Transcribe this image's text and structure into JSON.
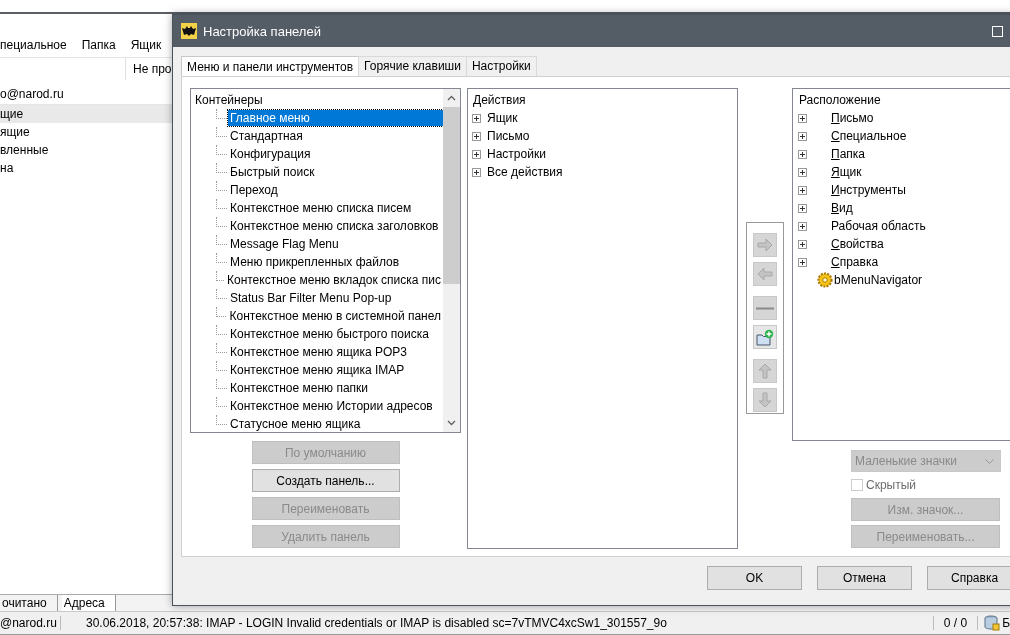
{
  "background_app": {
    "menu": [
      "пециальное",
      "Папка",
      "Ящик"
    ],
    "column_header": "Не про",
    "account": "o@narod.ru",
    "folders": [
      {
        "label": "щие",
        "selected": true
      },
      {
        "label": "ящие",
        "selected": false
      },
      {
        "label": "вленные",
        "selected": false
      },
      {
        "label": "на",
        "selected": false
      }
    ],
    "bottom_tabs": [
      {
        "label": "очитано",
        "selected": false
      },
      {
        "label": "Адреса",
        "selected": true
      }
    ]
  },
  "dialog": {
    "title": "Настройка панелей",
    "tabs": [
      {
        "label": "Меню и панели инструментов",
        "selected": true
      },
      {
        "label": "Горячие клавиши",
        "selected": false
      },
      {
        "label": "Настройки",
        "selected": false
      }
    ],
    "containers": {
      "heading": "Контейнеры",
      "items": [
        {
          "label": "Главное меню",
          "selected": true
        },
        {
          "label": "Стандартная",
          "selected": false
        },
        {
          "label": "Конфигурация",
          "selected": false
        },
        {
          "label": "Быстрый поиск",
          "selected": false
        },
        {
          "label": "Переход",
          "selected": false
        },
        {
          "label": "Контекстное меню списка писем",
          "selected": false
        },
        {
          "label": "Контекстное меню списка заголовков",
          "selected": false
        },
        {
          "label": "Message Flag Menu",
          "selected": false
        },
        {
          "label": "Меню прикрепленных файлов",
          "selected": false
        },
        {
          "label": "Контекстное меню вкладок списка пис",
          "selected": false
        },
        {
          "label": "Status Bar Filter Menu Pop-up",
          "selected": false
        },
        {
          "label": "Контекстное меню в системной панел",
          "selected": false
        },
        {
          "label": "Контекстное меню быстрого поиска",
          "selected": false
        },
        {
          "label": "Контекстное меню ящика POP3",
          "selected": false
        },
        {
          "label": "Контекстное меню ящика IMAP",
          "selected": false
        },
        {
          "label": "Контекстное меню папки",
          "selected": false
        },
        {
          "label": "Контекстное меню Истории адресов",
          "selected": false
        },
        {
          "label": "Статусное меню ящика",
          "selected": false
        }
      ]
    },
    "actions": {
      "heading": "Действия",
      "items": [
        {
          "label": "Ящик",
          "expanded": false
        },
        {
          "label": "Письмо",
          "expanded": false
        },
        {
          "label": "Настройки",
          "expanded": false
        },
        {
          "label": "Все действия",
          "expanded": false
        }
      ]
    },
    "toolbar": [
      {
        "kind": "arrow-right",
        "disabled": true
      },
      {
        "kind": "arrow-left",
        "disabled": true
      },
      {
        "kind": "separator",
        "disabled": true
      },
      {
        "kind": "new-folder",
        "disabled": false
      },
      {
        "kind": "arrow-up",
        "disabled": true
      },
      {
        "kind": "arrow-down",
        "disabled": true
      }
    ],
    "location": {
      "heading": "Расположение",
      "items": [
        {
          "kind": "group",
          "label": "Письмо",
          "underline_first": true
        },
        {
          "kind": "group",
          "label": "Специальное",
          "underline_first": true
        },
        {
          "kind": "group",
          "label": "Папка",
          "underline_first": true
        },
        {
          "kind": "group",
          "label": "Ящик",
          "underline_first": true
        },
        {
          "kind": "group",
          "label": "Инструменты",
          "underline_first": true
        },
        {
          "kind": "group",
          "label": "Вид",
          "underline_first": true
        },
        {
          "kind": "group",
          "label": "Рабочая область",
          "underline_first": false
        },
        {
          "kind": "group",
          "label": "Свойства",
          "underline_first": true
        },
        {
          "kind": "group",
          "label": "Справка",
          "underline_first": true
        },
        {
          "kind": "plugin",
          "label": "bMenuNavigator",
          "underline_first": false
        }
      ]
    },
    "container_buttons": [
      {
        "label": "По умолчанию",
        "disabled": true
      },
      {
        "label": "Создать панель...",
        "disabled": false
      },
      {
        "label": "Переименовать",
        "disabled": true
      },
      {
        "label": "Удалить панель",
        "disabled": true
      }
    ],
    "icon_size": {
      "value": "Маленькие значки",
      "disabled": true
    },
    "hidden": {
      "label": "Скрытый",
      "checked": false,
      "disabled": true
    },
    "item_buttons": [
      {
        "label": "Изм. значок...",
        "disabled": true
      },
      {
        "label": "Переименовать...",
        "disabled": true
      }
    ],
    "footer_buttons": [
      "OK",
      "Отмена",
      "Справка"
    ]
  },
  "status_bar": {
    "account": "@narod.ru",
    "message": "30.06.2018, 20:57:38: IMAP  - LOGIN Invalid credentials or IMAP is disabled sc=7vTMVC4xcSw1_301557_9o",
    "counter": "0 / 0",
    "label": "Б"
  }
}
